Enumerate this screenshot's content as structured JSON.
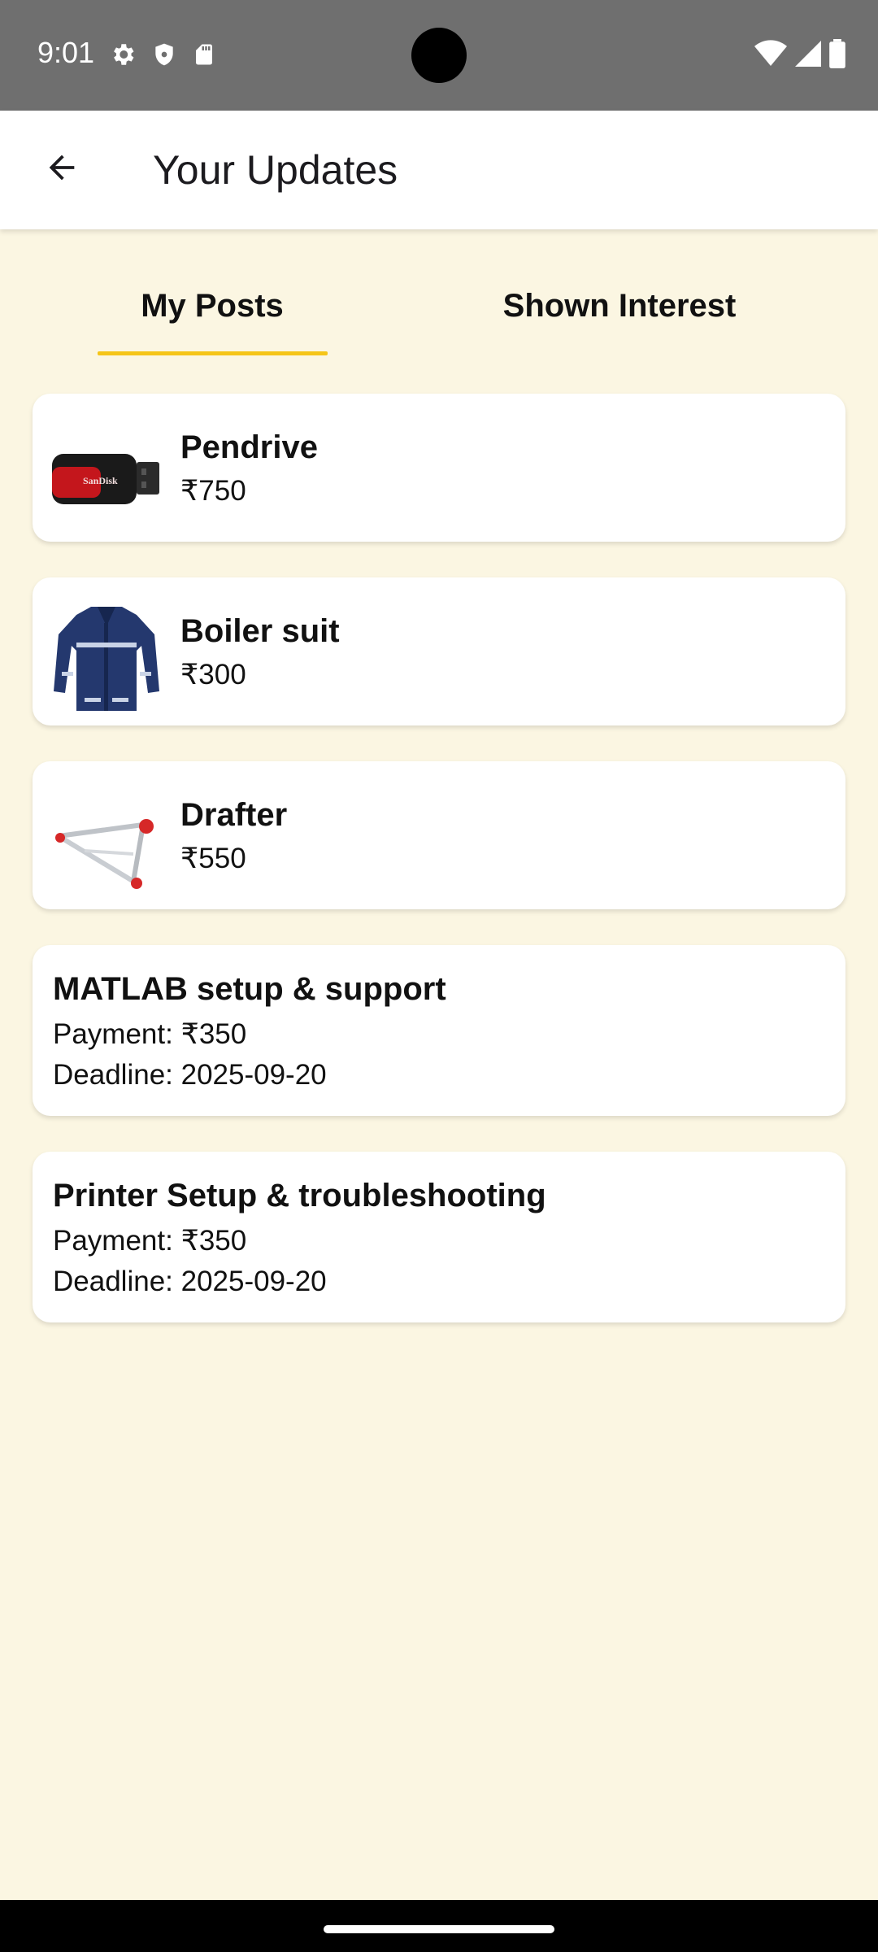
{
  "status_bar": {
    "time": "9:01"
  },
  "app_bar": {
    "title": "Your Updates"
  },
  "tabs": [
    {
      "label": "My Posts",
      "selected": true
    },
    {
      "label": "Shown Interest",
      "selected": false
    }
  ],
  "colors": {
    "background": "#fbf6e2",
    "tab_indicator": "#f5c518",
    "status_bar": "#6f6f6f"
  },
  "posts": [
    {
      "title": "Pendrive",
      "price": "₹750",
      "image": "pendrive-thumbnail"
    },
    {
      "title": "Boiler suit",
      "price": "₹300",
      "image": "boiler-suit-thumbnail"
    },
    {
      "title": "Drafter",
      "price": "₹550",
      "image": "drafter-thumbnail"
    }
  ],
  "tasks": [
    {
      "title": "MATLAB setup & support",
      "payment": "Payment: ₹350",
      "deadline": "Deadline: 2025-09-20"
    },
    {
      "title": "Printer Setup & troubleshooting",
      "payment": "Payment: ₹350",
      "deadline": "Deadline: 2025-09-20"
    }
  ]
}
